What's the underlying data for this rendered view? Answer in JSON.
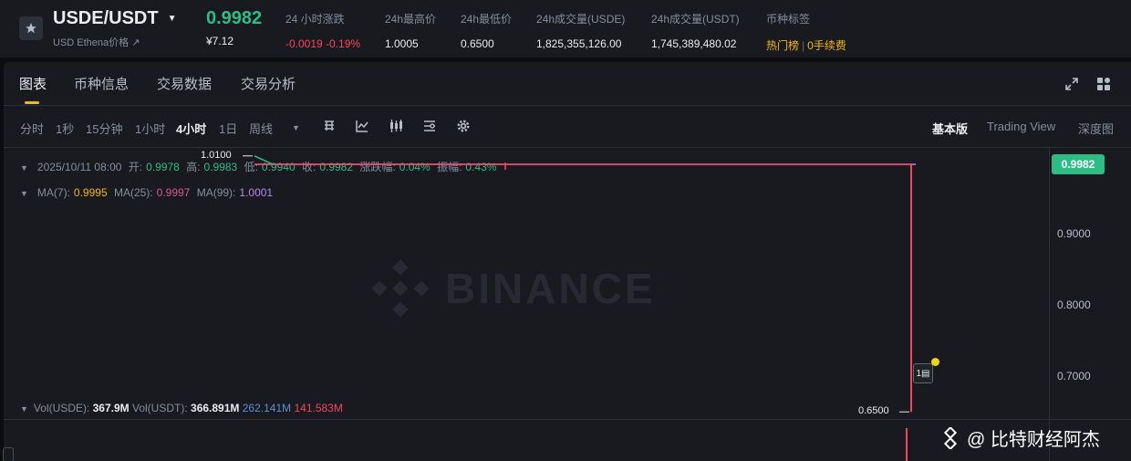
{
  "ticker": {
    "symbol": "USDE/USDT",
    "symbol_sub": "USD Ethena价格 ↗",
    "price": "0.9982",
    "price_cny": "¥7.12",
    "stats": [
      {
        "label": "24 小时涨跌",
        "value": "-0.0019 -0.19%",
        "color": "red"
      },
      {
        "label": "24h最高价",
        "value": "1.0005"
      },
      {
        "label": "24h最低价",
        "value": "0.6500"
      },
      {
        "label": "24h成交量(USDE)",
        "value": "1,825,355,126.00"
      },
      {
        "label": "24h成交量(USDT)",
        "value": "1,745,389,480.02"
      }
    ],
    "tags_label": "币种标签",
    "tag_hot": "热门榜",
    "tag_fee": "0手续费"
  },
  "tabs": [
    "图表",
    "币种信息",
    "交易数据",
    "交易分析"
  ],
  "toolbar": {
    "intervals": [
      "分时",
      "1秒",
      "15分钟",
      "1小时",
      "4小时",
      "1日",
      "周线"
    ],
    "active_interval": "4小时",
    "views": [
      "基本版",
      "Trading View",
      "深度图"
    ],
    "active_view": "基本版"
  },
  "ohlc": {
    "date": "2025/10/11 08:00",
    "open_label": "开:",
    "open": "0.9978",
    "high_label": "高:",
    "high": "0.9983",
    "low_label": "低:",
    "low": "0.9940",
    "close_label": "收:",
    "close": "0.9982",
    "change_label": "涨跌幅:",
    "change": "0.04%",
    "amp_label": "振幅:",
    "amp": "0.43%"
  },
  "ma": {
    "ma7_label": "MA(7):",
    "ma7": "0.9995",
    "ma25_label": "MA(25):",
    "ma25": "0.9997",
    "ma99_label": "MA(99):",
    "ma99": "1.0001"
  },
  "chart": {
    "watermark": "BINANCE",
    "y_ticks": [
      "0.9000",
      "0.8000",
      "0.7000"
    ],
    "current_price": "0.9982",
    "high_marker": "1.0100",
    "low_marker": "0.6500",
    "colors": {
      "up": "#2ebd85",
      "down": "#f6465d",
      "accent": "#f0b90b"
    }
  },
  "chart_data": {
    "type": "line",
    "ylim": [
      0.64,
      1.02
    ],
    "y_ticks": [
      0.9,
      0.8,
      0.7
    ],
    "current": 0.9982,
    "period_high": 1.01,
    "period_low": 0.65,
    "last_candle": {
      "open": 0.9978,
      "high": 0.9983,
      "low": 0.94,
      "close": 0.9982
    }
  },
  "volume": {
    "usde_label": "Vol(USDE):",
    "usde": "367.9M",
    "usdt_label": "Vol(USDT):",
    "usdt": "366.891M",
    "v2": "262.141M",
    "v3": "141.583M"
  },
  "credit": "@ 比特财经阿杰"
}
